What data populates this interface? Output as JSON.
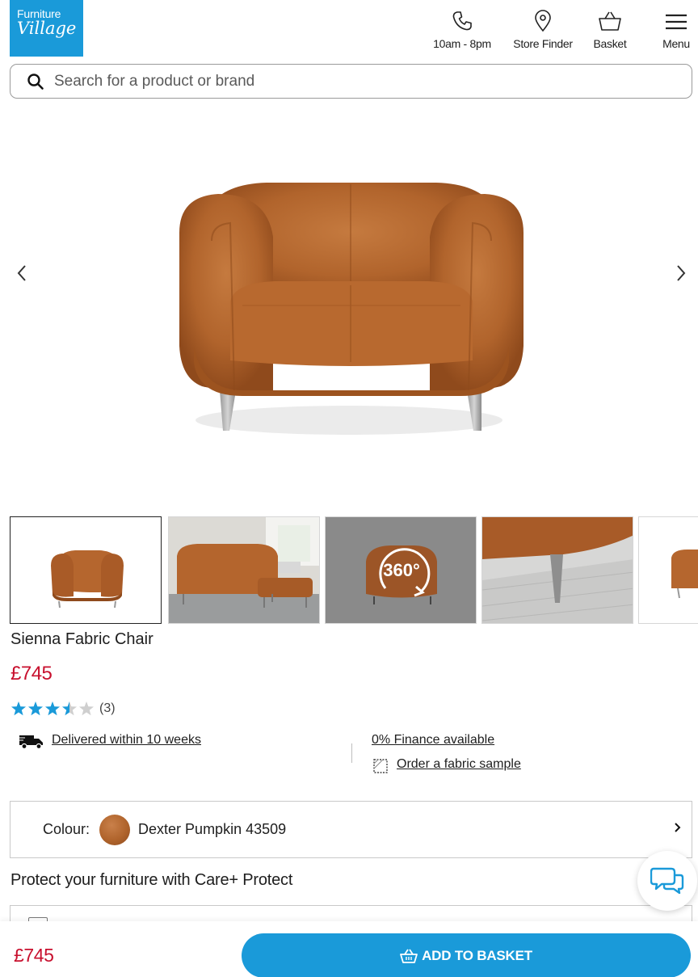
{
  "brand": {
    "logo_line1": "Furniture",
    "logo_line2": "Village",
    "accent": "#1a9ad9",
    "price_color": "#c8102e"
  },
  "header": {
    "hours_label": "10am - 8pm",
    "store_label": "Store Finder",
    "basket_label": "Basket",
    "menu_label": "Menu"
  },
  "search": {
    "placeholder": "Search for a product or brand"
  },
  "gallery": {
    "thumbnails": [
      "chair-front",
      "room-scene",
      "360-view",
      "leg-detail",
      "side-view"
    ],
    "view360_label": "360°"
  },
  "product": {
    "title": "Sienna Fabric Chair",
    "price": "£745",
    "rating": 3.5,
    "rating_max": 5,
    "review_count": "(3)",
    "delivery": "Delivered within 10 weeks",
    "finance": "0% Finance available",
    "sample": "Order a fabric sample"
  },
  "colour": {
    "label": "Colour:",
    "value": "Dexter Pumpkin 43509"
  },
  "protect": {
    "title": "Protect your furniture with Care+ Protect"
  },
  "footer": {
    "price": "£745",
    "button_label": "ADD TO BASKET"
  }
}
